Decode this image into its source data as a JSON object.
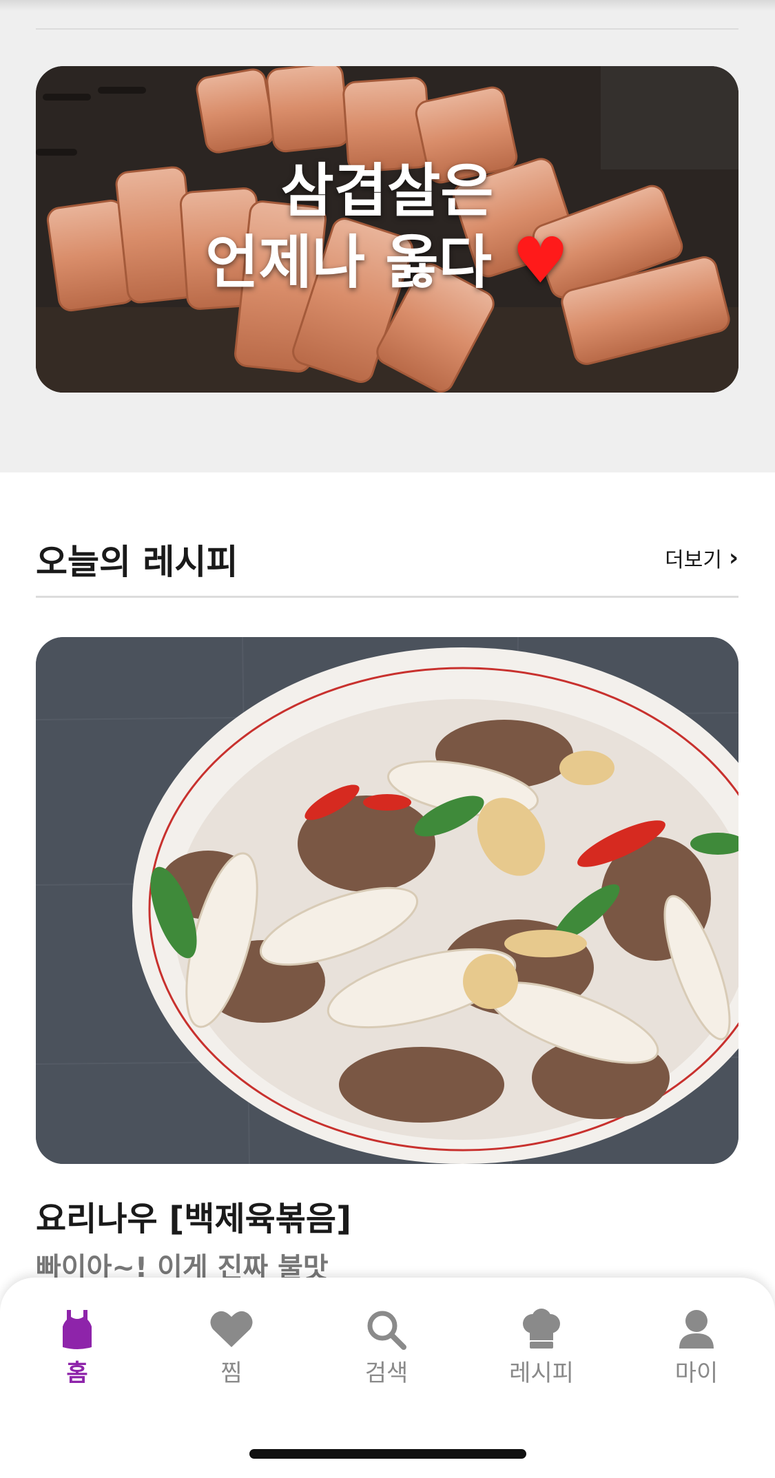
{
  "banner": {
    "line1": "삼겹살은",
    "line2": "언제나 옳다",
    "heart": "♥"
  },
  "section": {
    "title": "오늘의 레시피",
    "more_label": "더보기",
    "more_icon": "chevron-right-icon"
  },
  "recipe": {
    "title": "요리나우 [백제육볶음]",
    "subtitle": "빠이아~! 이게 진짜 불맛"
  },
  "tabbar": {
    "active_color": "#8e24aa",
    "inactive_color": "#8a8a8a",
    "items": [
      {
        "label": "홈",
        "icon": "apron-icon",
        "active": true
      },
      {
        "label": "찜",
        "icon": "heart-icon",
        "active": false
      },
      {
        "label": "검색",
        "icon": "search-icon",
        "active": false
      },
      {
        "label": "레시피",
        "icon": "chef-hat-icon",
        "active": false
      },
      {
        "label": "마이",
        "icon": "person-icon",
        "active": false
      }
    ]
  }
}
